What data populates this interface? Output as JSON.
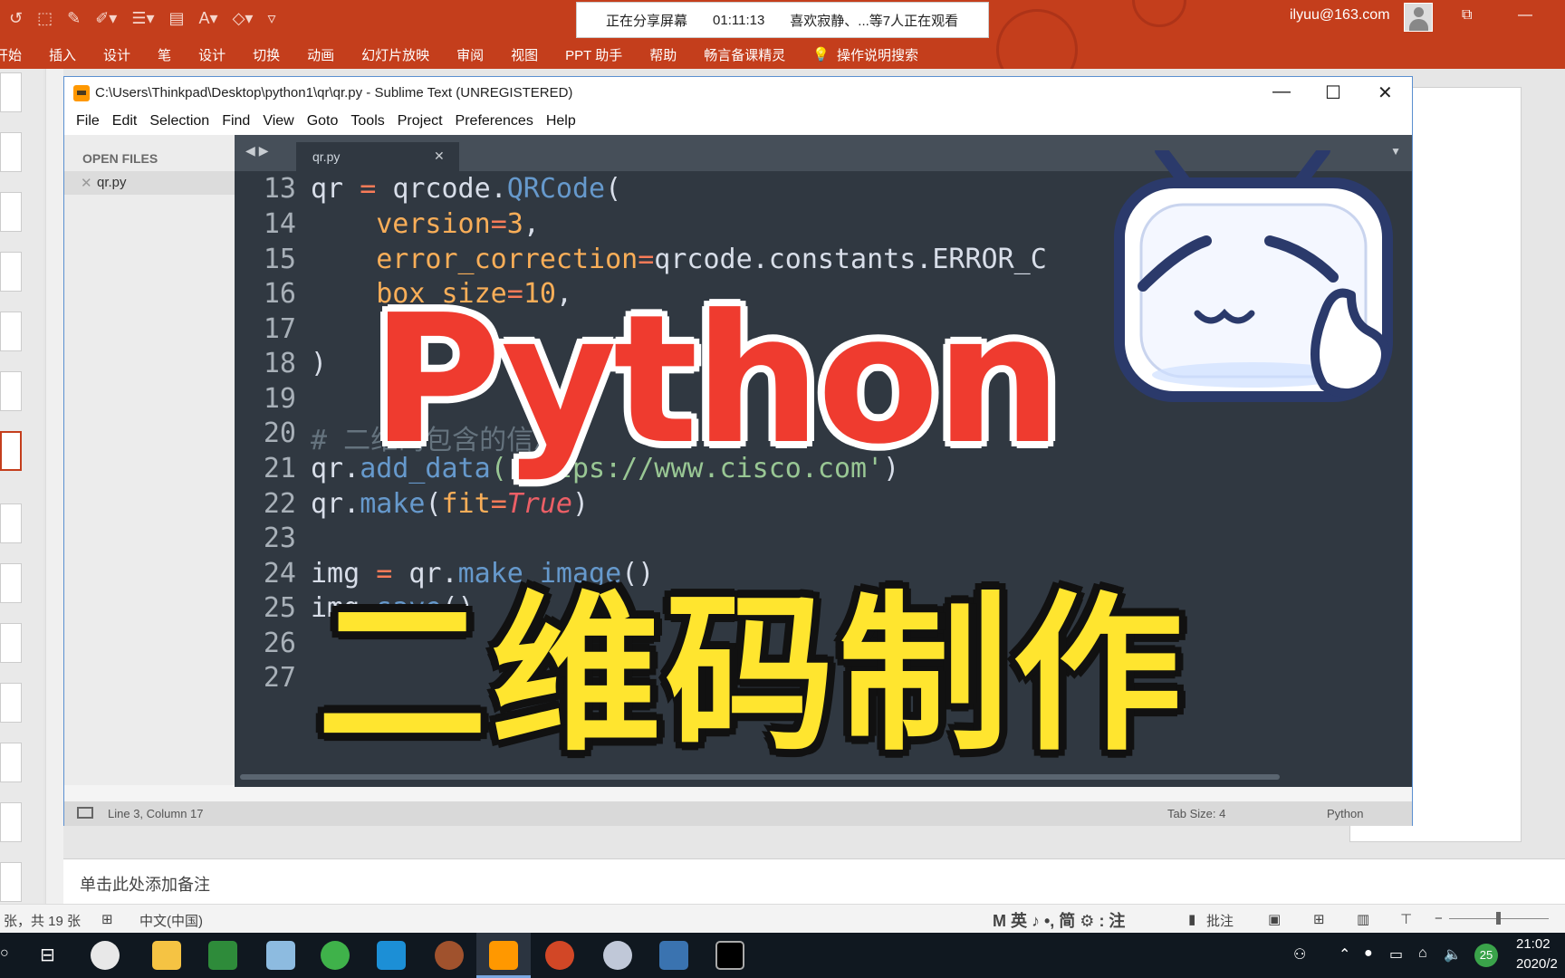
{
  "ppt": {
    "share_status": "正在分享屏幕",
    "share_time": "01:11:13",
    "share_viewers": "喜欢寂静、...等7人正在观看",
    "user_email": "ilyuu@163.com",
    "ribbon_tabs": [
      "开始",
      "插入",
      "设计",
      "笔",
      "设计",
      "切换",
      "动画",
      "幻灯片放映",
      "审阅",
      "视图",
      "PPT 助手",
      "帮助",
      "畅言备课精灵"
    ],
    "tell_me": "操作说明搜索",
    "notes_placeholder": "单击此处添加备注",
    "status_slide": "张，共 19 张",
    "status_lang": "中文(中国)",
    "status_ime": "M 英 ♪ •, 简 ⚙ : 注",
    "status_comments": "批注"
  },
  "sublime": {
    "title": "C:\\Users\\Thinkpad\\Desktop\\python1\\qr\\qr.py - Sublime Text (UNREGISTERED)",
    "menu": [
      "File",
      "Edit",
      "Selection",
      "Find",
      "View",
      "Goto",
      "Tools",
      "Project",
      "Preferences",
      "Help"
    ],
    "sidebar_header": "OPEN FILES",
    "open_file": "qr.py",
    "tab_name": "qr.py",
    "line_numbers": [
      "13",
      "14",
      "15",
      "16",
      "17",
      "18",
      "19",
      "20",
      "21",
      "22",
      "23",
      "24",
      "25",
      "26",
      "27"
    ],
    "status_pos": "Line 3, Column 17",
    "status_tab": "Tab Size: 4",
    "status_syntax": "Python"
  },
  "overlay": {
    "title_en": "Python",
    "title_cn": "二维码制作"
  },
  "taskbar": {
    "time": "21:02",
    "date": "2020/2",
    "badge": "25"
  },
  "colors": {
    "ppt_accent": "#c43e1c",
    "editor_bg": "#303841",
    "python_red": "#ef3b2f",
    "cn_yellow": "#ffe52f"
  }
}
